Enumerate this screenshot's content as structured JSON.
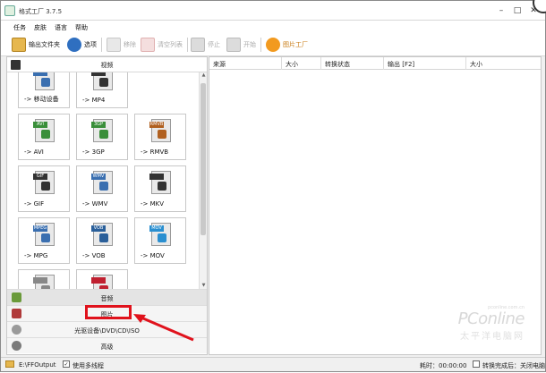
{
  "window": {
    "title": "格式工厂 3.7.5",
    "minimize": "–",
    "maximize": "□",
    "close": "✕"
  },
  "menu": [
    "任务",
    "皮肤",
    "语言",
    "帮助"
  ],
  "toolbar": {
    "output_folder": "输出文件夹",
    "options": "选项",
    "remove": "移除",
    "clear_list": "清空列表",
    "stop": "停止",
    "start": "开始",
    "picture_factory": "图片工厂"
  },
  "left": {
    "video_header": "视频",
    "tiles": [
      {
        "tag": "",
        "label": "-> 移动设备",
        "color": "#3a6fb0"
      },
      {
        "tag": "",
        "label": "-> MP4",
        "color": "#333333"
      },
      {
        "tag": "AVI",
        "label": "-> AVI",
        "color": "#3a8f3a"
      },
      {
        "tag": "3GP",
        "label": "-> 3GP",
        "color": "#3a8f3a"
      },
      {
        "tag": "RMVB",
        "label": "-> RMVB",
        "color": "#b06020"
      },
      {
        "tag": "GIF",
        "label": "-> GIF",
        "color": "#333333"
      },
      {
        "tag": "WMV",
        "label": "-> WMV",
        "color": "#3a6fb0"
      },
      {
        "tag": "",
        "label": "-> MKV",
        "color": "#333333"
      },
      {
        "tag": "MPEG",
        "label": "-> MPG",
        "color": "#3a6fb0"
      },
      {
        "tag": "VOB",
        "label": "-> VOB",
        "color": "#2a5f9a"
      },
      {
        "tag": "MOV",
        "label": "-> MOV",
        "color": "#2a8fd0"
      },
      {
        "tag": "",
        "label": "",
        "color": "#888888"
      },
      {
        "tag": "",
        "label": "",
        "color": "#c02030"
      }
    ],
    "categories": {
      "audio": "音频",
      "picture": "图片",
      "disc": "光驱设备\\DVD\\CD\\ISO",
      "advanced": "高级"
    }
  },
  "list": {
    "columns": [
      "来源",
      "大小",
      "转换状态",
      "输出 [F2]",
      "大小"
    ]
  },
  "watermark": {
    "brand": "PConline",
    "site": "太平洋电脑网",
    "tag": "pconline.com.cn"
  },
  "status": {
    "output_path": "E:\\FFOutput",
    "multithread_label": "使用多线程",
    "multithread_checked": true,
    "elapsed": "耗时：00:00:00",
    "after_done": "转换完成后：关闭电脑",
    "after_done_checked": false
  },
  "colors": {
    "highlight": "#e0121c",
    "accent": "#f29a1f"
  }
}
